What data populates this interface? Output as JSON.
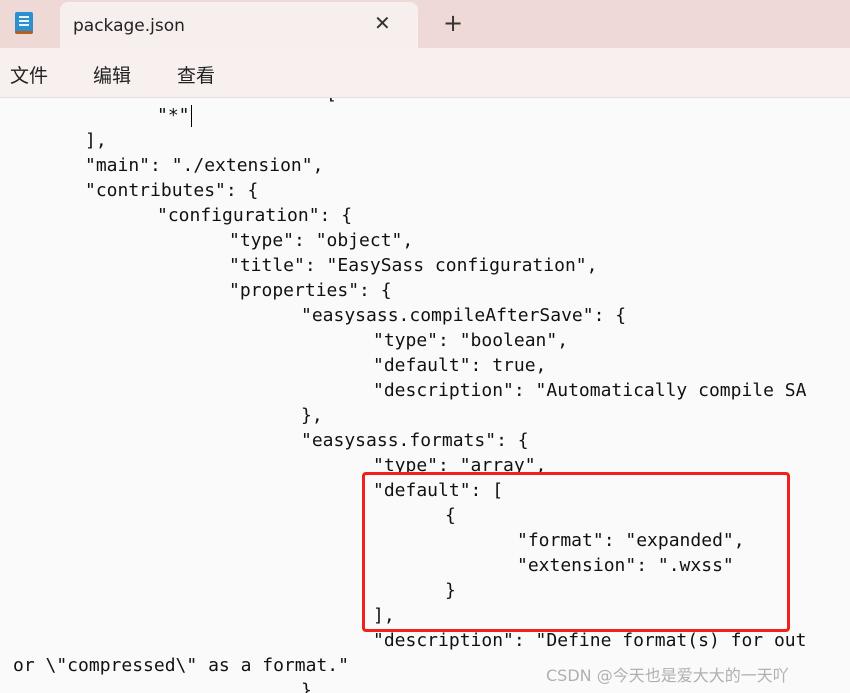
{
  "window": {
    "tab_title": "package.json",
    "close_icon": "close-icon",
    "new_tab_icon": "plus-icon",
    "app_icon": "notepad-icon"
  },
  "menu": [
    "文件",
    "编辑",
    "查看"
  ],
  "editor": {
    "top_partial": "[",
    "lines": [
      {
        "tabs": 2,
        "text": "\"*\"",
        "cursor": true
      },
      {
        "tabs": 1,
        "text": "],"
      },
      {
        "tabs": 1,
        "text": "\"main\": \"./extension\","
      },
      {
        "tabs": 1,
        "text": "\"contributes\": {"
      },
      {
        "tabs": 2,
        "text": "\"configuration\": {"
      },
      {
        "tabs": 3,
        "text": "\"type\": \"object\","
      },
      {
        "tabs": 3,
        "text": "\"title\": \"EasySass configuration\","
      },
      {
        "tabs": 3,
        "text": "\"properties\": {"
      },
      {
        "tabs": 4,
        "text": "\"easysass.compileAfterSave\": {"
      },
      {
        "tabs": 5,
        "text": "\"type\": \"boolean\","
      },
      {
        "tabs": 5,
        "text": "\"default\": true,"
      },
      {
        "tabs": 5,
        "text": "\"description\": \"Automatically compile SA"
      },
      {
        "tabs": 4,
        "text": "},"
      },
      {
        "tabs": 4,
        "text": "\"easysass.formats\": {"
      },
      {
        "tabs": 5,
        "text": "\"type\": \"array\","
      },
      {
        "tabs": 5,
        "text": "\"default\": ["
      },
      {
        "tabs": 6,
        "text": "{"
      },
      {
        "tabs": 7,
        "text": "\"format\": \"expanded\","
      },
      {
        "tabs": 7,
        "text": "\"extension\": \".wxss\""
      },
      {
        "tabs": 6,
        "text": "}"
      },
      {
        "tabs": 5,
        "text": "],"
      },
      {
        "tabs": 5,
        "text": "\"description\": \"Define format(s) for out"
      },
      {
        "tabs": 0,
        "text": "or \\\"compressed\\\" as a format.\""
      },
      {
        "tabs": 4,
        "text": "}"
      }
    ],
    "highlight_color": "#f0201a"
  },
  "watermark": "CSDN @今天也是爱大大的一天吖"
}
